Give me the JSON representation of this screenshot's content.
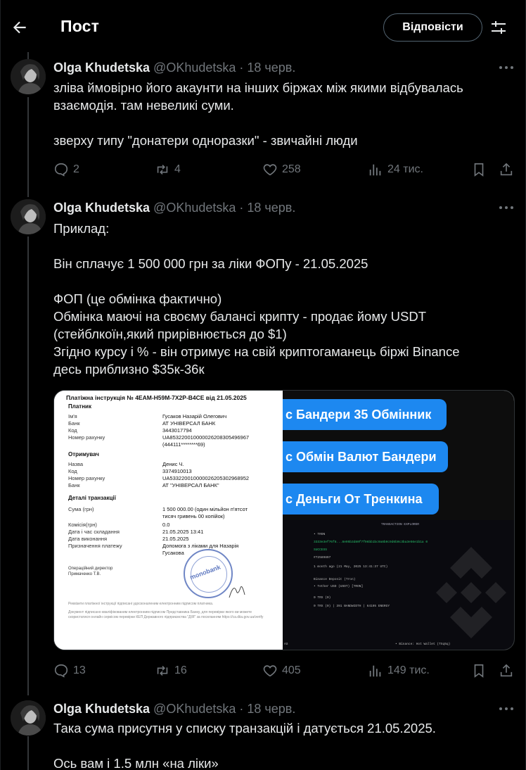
{
  "header": {
    "title": "Пост",
    "reply_button": "Відповісти"
  },
  "tweets": [
    {
      "name": "Olga Khudetska",
      "handle": "@OKhudetska",
      "date": " · 18 черв.",
      "text": "зліва ймовірно його акаунти на інших біржах між якими відбувалась\nвзаємодія. там невеликі суми.\n\nзверху типу \"донатери одноразки\" - звичайні люди",
      "replies": "2",
      "reposts": "4",
      "likes": "258",
      "views": "24 тис."
    },
    {
      "name": "Olga Khudetska",
      "handle": "@OKhudetska",
      "date": " · 18 черв.",
      "text": "Приклад:\n\nВін сплачує 1 500 000 грн за ліки ФОПу - 21.05.2025\n\nФОП (це обмінка фактично)\nОбмінка маючі на своєму балансі крипту - продає йому USDT\n(стейблкоїн,який прирівнюється до $1)\nЗгідно курсу і % - він отримує на свій криптогаманець біржі Binance\nдесь приблизно $35к-36к",
      "replies": "13",
      "reposts": "16",
      "likes": "405",
      "views": "149 тис."
    },
    {
      "name": "Olga Khudetska",
      "handle": "@OKhudetska",
      "date": " · 18 черв.",
      "text": "Така сума присутня у списку транзакцій і датується 21.05.2025.\n\nОсь вам і 1.5 млн «на ліки»"
    }
  ],
  "media": {
    "doc_title": "Платіжна інструкція № 4EAM-H59M-7X2P-B4CE від 21.05.2025",
    "payer_section": "Платник",
    "payer_rows": [
      {
        "label": "Ім'я",
        "value": "Гусаков Назарій Олегович"
      },
      {
        "label": "Банк",
        "value": "АТ УНІВЕРСАЛ БАНК"
      },
      {
        "label": "Код",
        "value": "3443017794"
      },
      {
        "label": "Номер рахунку",
        "value": "UA853220010000026208305496967"
      },
      {
        "label": "",
        "value": "(444111********69)"
      }
    ],
    "receiver_section": "Отримувач",
    "receiver_rows": [
      {
        "label": "Назва",
        "value": "Денис Ч."
      },
      {
        "label": "Код",
        "value": "3374910013"
      },
      {
        "label": "Номер рахунку",
        "value": "UA533220010000026205302968952"
      },
      {
        "label": "Банк",
        "value": "АТ \"УНІВЕРСАЛ БАНК\""
      }
    ],
    "tx_section": "Деталі транзакції",
    "tx_rows": [
      {
        "label": "Сума (грн)",
        "value": "1 500 000.00 (один мільйон п'ятсот"
      },
      {
        "label": "",
        "value": "тисяч гривень 00 копійок)"
      },
      {
        "label": "Комісія(грн)",
        "value": "0.0"
      },
      {
        "label": "Дата і час складання",
        "value": "21.05.2025 13:41"
      },
      {
        "label": "Дата виконання",
        "value": "21.05.2025"
      },
      {
        "label": "Призначення платежу",
        "value": "Допомога з ліками для Назарія"
      },
      {
        "label": "",
        "value": "Гусакова"
      }
    ],
    "director_line1": "Операційний директор",
    "director_line2": "Примаченко Т.В.",
    "stamp": "monobank",
    "fine_print_1": "Реквізити платіжної інструкції підписані удосконаленим електронним підписом платника.",
    "fine_print_2": "Документ підписано кваліфікованим електронним підписом Представника Банку, для перевірки якого ви можете скористатися онлайн сервісом перевірки КЕП Державного підприємства \"ДІЯ\" за посиланням https://ca.diia.gov.ua/verify",
    "chips": [
      "с Бандери 35 Обмінник",
      "с Обмін Валют Бандери",
      "с Деньги От Тренкина"
    ],
    "explorer_title": "TRANSACTION EXPLORER",
    "explorer_lines": [
      "• TRON",
      "3333e3ef76f8...8e95b3d80f7f96bb1bc9a8b0c9d6b0c3ba3e56e1b1a 0",
      "SUCCESS",
      "#72589897",
      "1 month ago  (21 May, 2025 13:41:37 UTC)",
      "Binance Deposit (Tron)",
      "• Tether USD (USDT) [TRON]",
      "0 TRX (0)",
      "0  TRX (0)   |   391 BANDWIDTH   |   64195 ENERGY",
      "• Binance: Hot Wallet (TXq5q)",
      "AS"
    ]
  }
}
